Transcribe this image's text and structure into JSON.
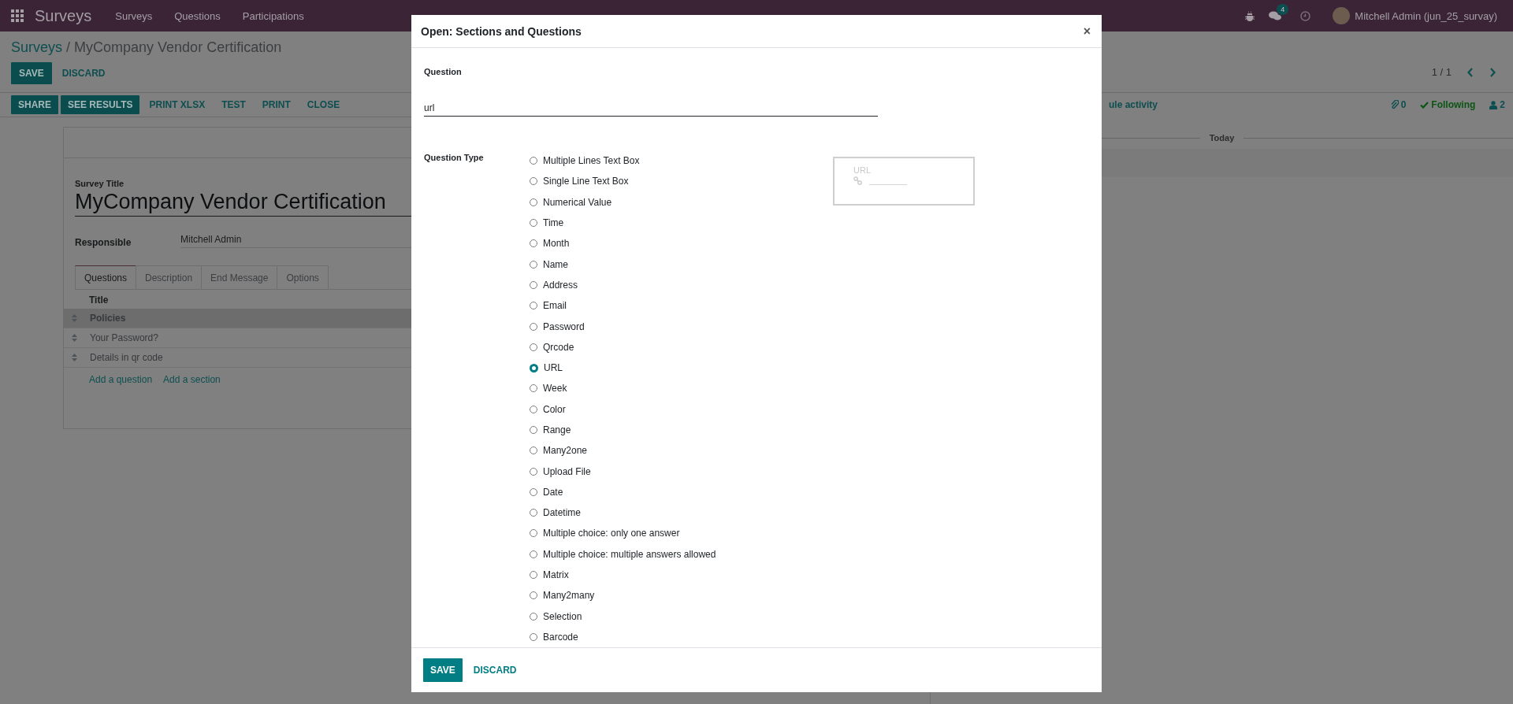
{
  "navbar": {
    "app_name": "Surveys",
    "menu": [
      "Surveys",
      "Questions",
      "Participations"
    ],
    "message_count": "4",
    "user": "Mitchell Admin (jun_25_survay)"
  },
  "breadcrumb": {
    "parent": "Surveys",
    "separator": "/",
    "current": "MyCompany Vendor Certification"
  },
  "form_buttons": [
    {
      "label": "SAVE",
      "kind": "primary"
    },
    {
      "label": "DISCARD",
      "kind": "link"
    }
  ],
  "pager": "1 / 1",
  "actions": [
    {
      "label": "SHARE",
      "kind": "primary"
    },
    {
      "label": "SEE RESULTS",
      "kind": "primary"
    },
    {
      "label": "PRINT XLSX",
      "kind": "link"
    },
    {
      "label": "TEST",
      "kind": "link"
    },
    {
      "label": "PRINT",
      "kind": "link"
    },
    {
      "label": "CLOSE",
      "kind": "link"
    }
  ],
  "chatter": {
    "schedule": "ule activity",
    "attachments": "0",
    "following": "Following",
    "followers": "2",
    "date_divider": "Today"
  },
  "sheet": {
    "title_label": "Survey Title",
    "title": "MyCompany Vendor Certification",
    "responsible_label": "Responsible",
    "responsible": "Mitchell Admin",
    "tabs": [
      {
        "label": "Questions",
        "selected": true
      },
      {
        "label": "Description",
        "selected": false
      },
      {
        "label": "End Message",
        "selected": false
      },
      {
        "label": "Options",
        "selected": false
      }
    ],
    "column": "Title",
    "rows": [
      {
        "title": "Policies",
        "kind": "section"
      },
      {
        "title": "Your Password?",
        "kind": "question"
      },
      {
        "title": "Details in qr code",
        "kind": "question"
      }
    ],
    "add_links": [
      "Add a question",
      "Add a section"
    ]
  },
  "modal": {
    "title": "Open: Sections and Questions",
    "close": "×",
    "question_label": "Question",
    "question_value": "url",
    "type_label": "Question Type",
    "types": [
      {
        "label": "Multiple Lines Text Box",
        "selected": false
      },
      {
        "label": "Single Line Text Box",
        "selected": false
      },
      {
        "label": "Numerical Value",
        "selected": false
      },
      {
        "label": "Time",
        "selected": false
      },
      {
        "label": "Month",
        "selected": false
      },
      {
        "label": "Name",
        "selected": false
      },
      {
        "label": "Address",
        "selected": false
      },
      {
        "label": "Email",
        "selected": false
      },
      {
        "label": "Password",
        "selected": false
      },
      {
        "label": "Qrcode",
        "selected": false
      },
      {
        "label": "URL",
        "selected": true
      },
      {
        "label": "Week",
        "selected": false
      },
      {
        "label": "Color",
        "selected": false
      },
      {
        "label": "Range",
        "selected": false
      },
      {
        "label": "Many2one",
        "selected": false
      },
      {
        "label": "Upload File",
        "selected": false
      },
      {
        "label": "Date",
        "selected": false
      },
      {
        "label": "Datetime",
        "selected": false
      },
      {
        "label": "Multiple choice: only one answer",
        "selected": false
      },
      {
        "label": "Multiple choice: multiple answers allowed",
        "selected": false
      },
      {
        "label": "Matrix",
        "selected": false
      },
      {
        "label": "Many2many",
        "selected": false
      },
      {
        "label": "Selection",
        "selected": false
      },
      {
        "label": "Barcode",
        "selected": false
      }
    ],
    "preview_label": "URL",
    "footer_buttons": [
      {
        "label": "SAVE",
        "kind": "primary"
      },
      {
        "label": "DISCARD",
        "kind": "link"
      }
    ]
  }
}
